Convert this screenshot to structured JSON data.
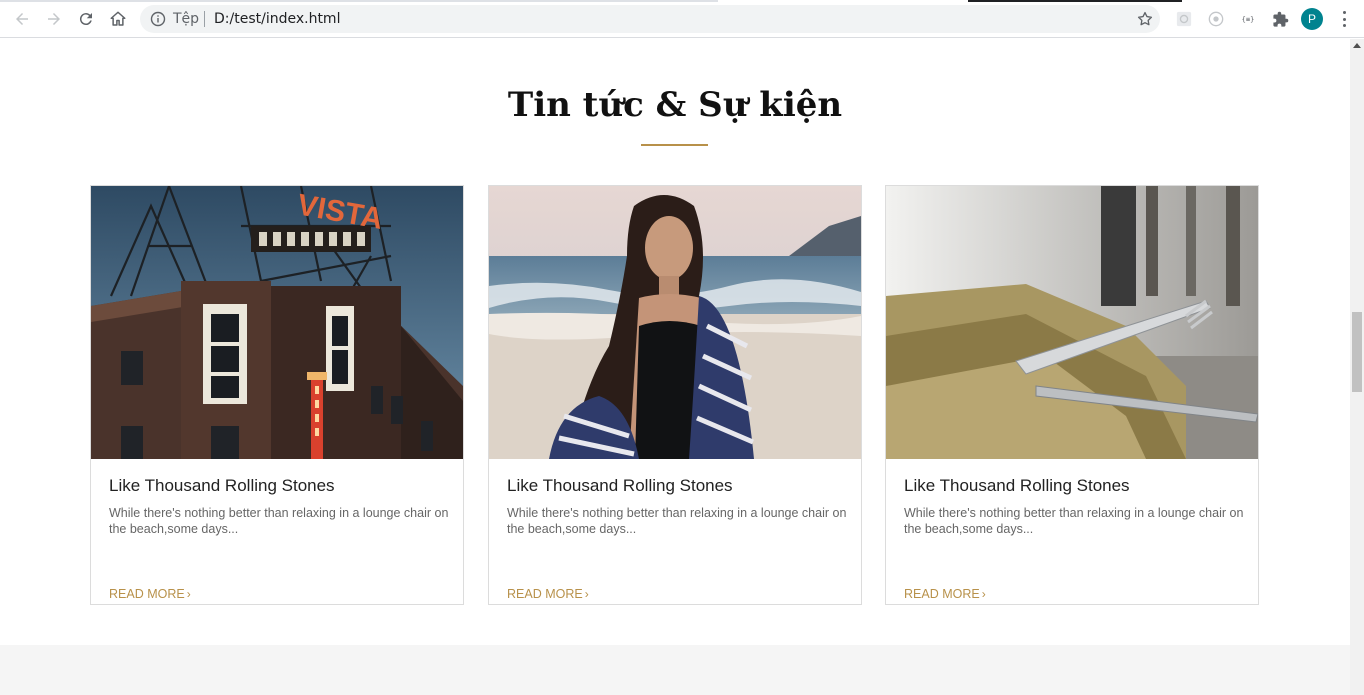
{
  "browser": {
    "scheme_label": "Tệp",
    "url": "D:/test/index.html",
    "profile_initial": "P",
    "colors": {
      "avatar": "#00838f",
      "omnibox": "#f1f3f4"
    }
  },
  "section": {
    "title": "Tin tức & Sự kiện",
    "accent_color": "#b8914a"
  },
  "cards": [
    {
      "title": "Like Thousand Rolling Stones",
      "description": "While there's nothing better than relaxing in a lounge chair on the beach,some days...",
      "read_more": "READ MORE",
      "image": "vista-hotel-building-photo"
    },
    {
      "title": "Like Thousand Rolling Stones",
      "description": "While there's nothing better than relaxing in a lounge chair on the beach,some days...",
      "read_more": "READ MORE",
      "image": "woman-on-beach-photo"
    },
    {
      "title": "Like Thousand Rolling Stones",
      "description": "While there's nothing better than relaxing in a lounge chair on the beach,some days...",
      "read_more": "READ MORE",
      "image": "fork-knife-napkin-photo"
    }
  ]
}
